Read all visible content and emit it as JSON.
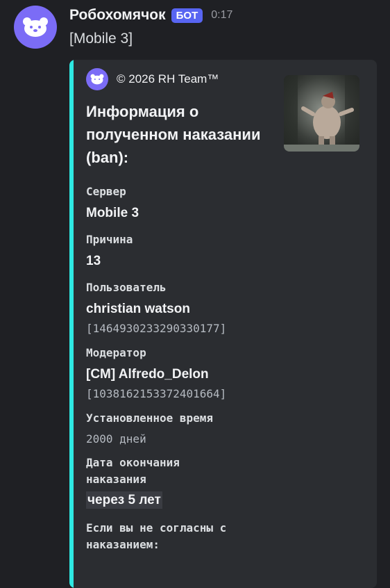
{
  "message": {
    "author": "Робохомячок",
    "badge": "БОТ",
    "time": "0:17",
    "text": "[Mobile 3]"
  },
  "embed": {
    "author_name": "© 2026 RH Team™",
    "title": "Информация о полученном наказании (ban):",
    "accent_color": "#2ee8e2",
    "fields": {
      "server_label": "Сервер",
      "server_value": "Mobile 3",
      "reason_label": "Причина",
      "reason_value": "13",
      "user_label": "Пользователь",
      "user_name": "christian watson",
      "user_id": "[1464930233290330177]",
      "moderator_label": "Модератор",
      "moderator_name": "[CM] Alfredo_Delon",
      "moderator_id": "[1038162153372401664]",
      "duration_label": "Установленное время",
      "duration_value": "2000 дней",
      "end_label_1": "Дата окончания",
      "end_label_2": "наказания",
      "end_value": "через 5 лет",
      "disagree_1": "Если вы не согласны с",
      "disagree_2": "наказанием:"
    }
  },
  "icons": {
    "avatar": "hamster-icon",
    "embed_avatar": "hamster-icon"
  }
}
